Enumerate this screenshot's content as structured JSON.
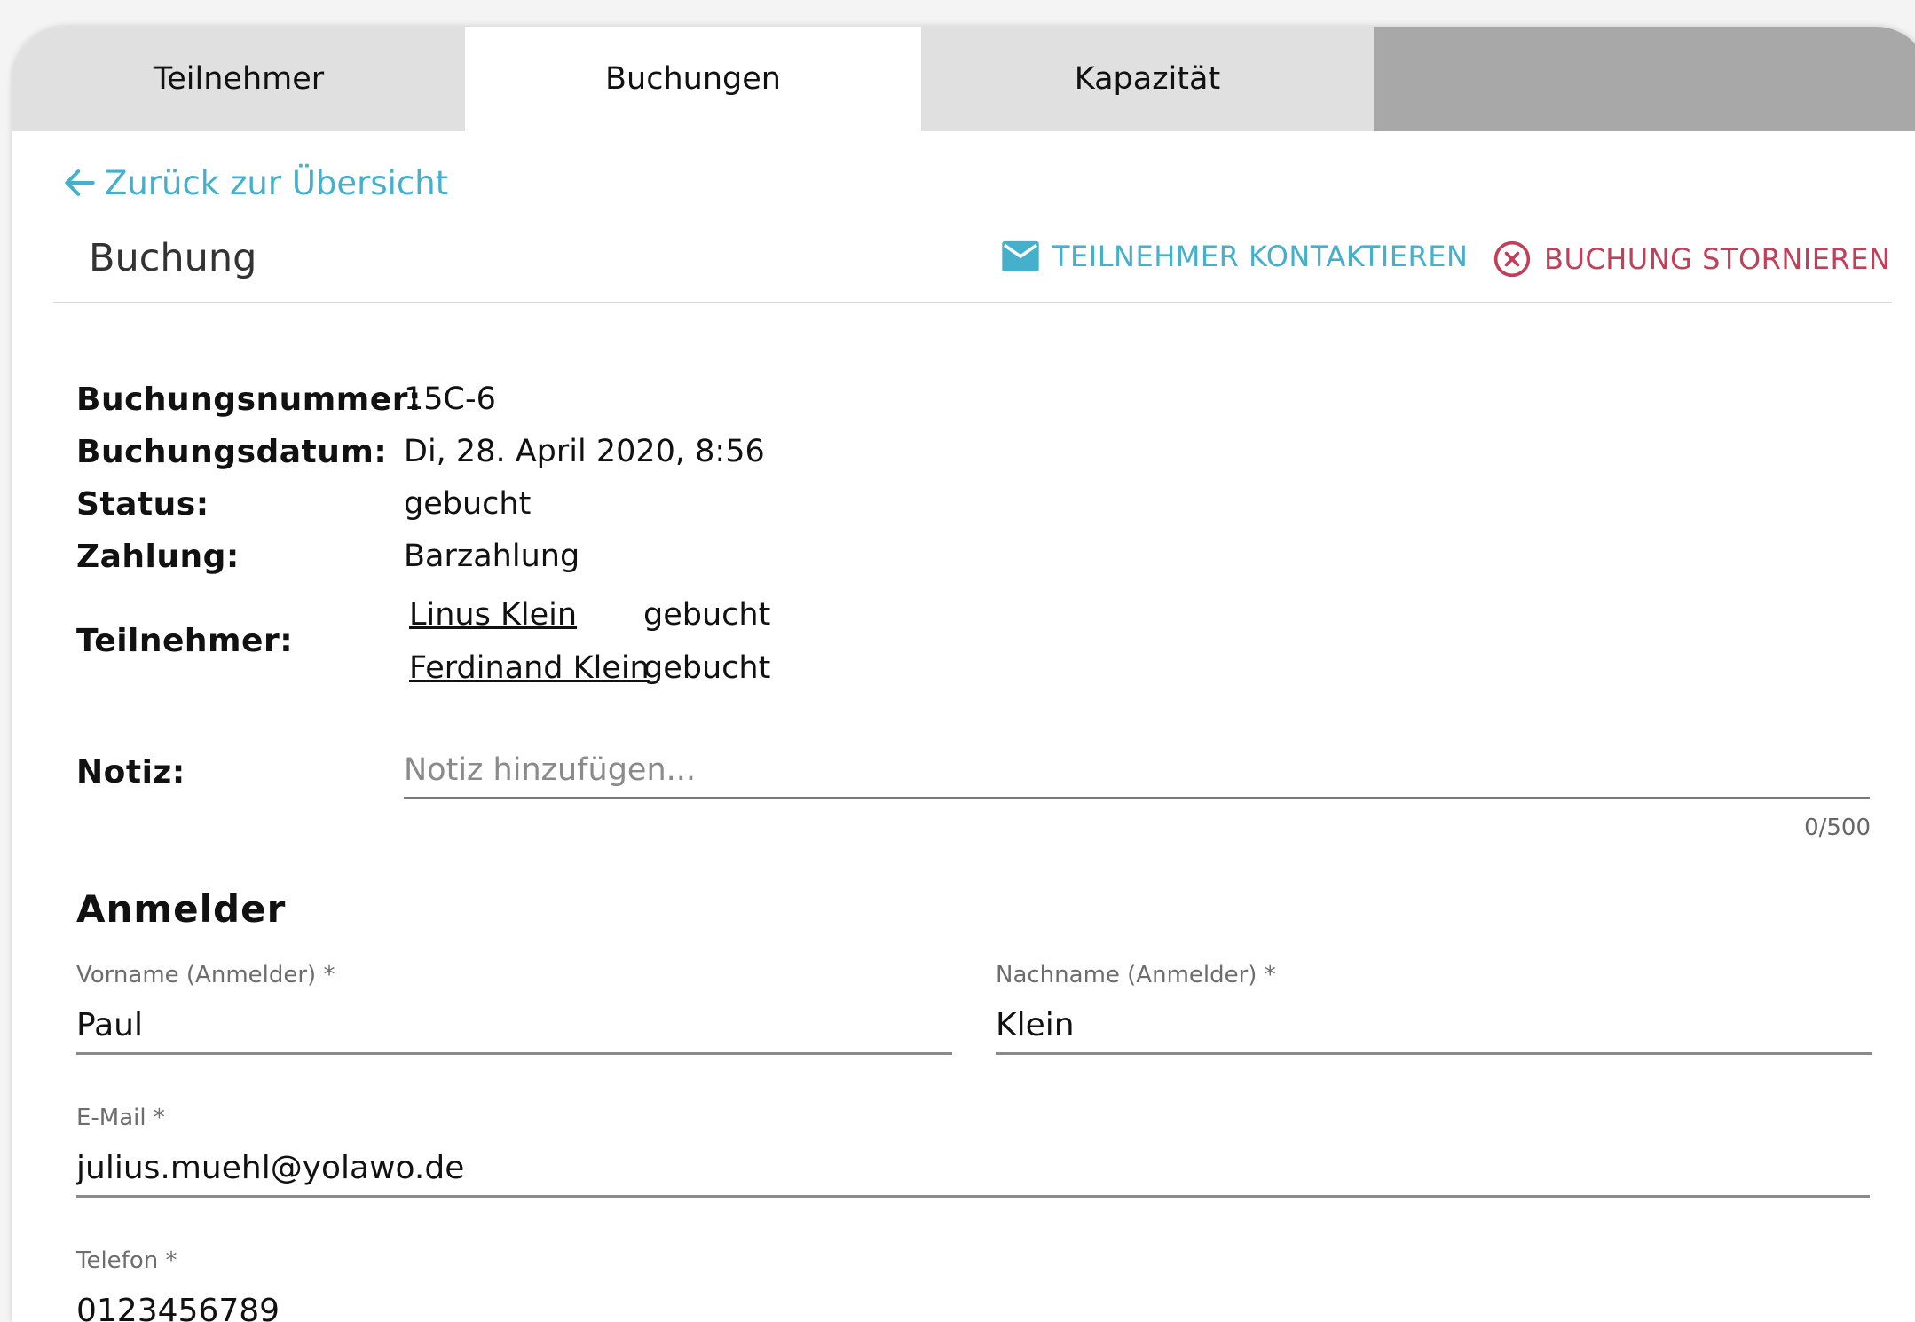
{
  "tabs": [
    {
      "label": "Teilnehmer"
    },
    {
      "label": "Buchungen"
    },
    {
      "label": "Kapazität"
    }
  ],
  "back_link": "Zurück zur Übersicht",
  "section": {
    "title": "Buchung",
    "contact_button": "TEILNEHMER KONTAKTIEREN",
    "cancel_button": "BUCHUNG STORNIEREN"
  },
  "booking": {
    "number_label": "Buchungsnummer:",
    "number_value": "15C-6",
    "date_label": "Buchungsdatum:",
    "date_value": "Di, 28. April 2020, 8:56",
    "status_label": "Status:",
    "status_value": "gebucht",
    "payment_label": "Zahlung:",
    "payment_value": "Barzahlung",
    "participants_label": "Teilnehmer:",
    "participants": [
      {
        "name": "Linus Klein",
        "status": "gebucht"
      },
      {
        "name": "Ferdinand Klein",
        "status": "gebucht"
      }
    ],
    "note_label": "Notiz:",
    "note_placeholder": "Notiz hinzufügen...",
    "note_value": "",
    "note_counter": "0/500"
  },
  "registrant": {
    "heading": "Anmelder",
    "first_name_label": "Vorname (Anmelder) *",
    "first_name_value": "Paul",
    "last_name_label": "Nachname (Anmelder) *",
    "last_name_value": "Klein",
    "email_label": "E-Mail *",
    "email_value": "julius.muehl@yolawo.de",
    "phone_label": "Telefon *",
    "phone_value": "0123456789"
  },
  "colors": {
    "accent": "#45b0cc",
    "danger": "#c0405a",
    "tab_inactive": "#e0e0e0",
    "tab_filler": "#a8a8a8"
  },
  "icons": {
    "back": "arrow-left-icon",
    "contact": "mail-icon",
    "cancel": "close-circle-icon"
  }
}
